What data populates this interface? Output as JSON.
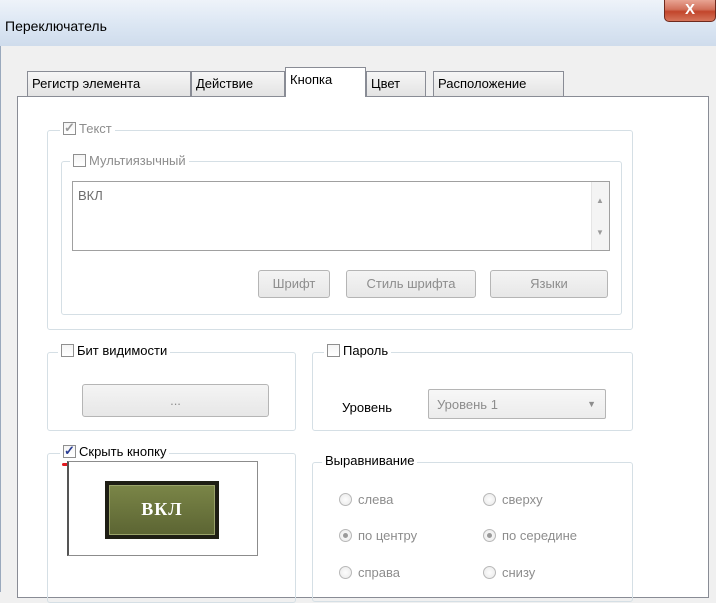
{
  "window": {
    "title": "Переключатель",
    "close_label": "X"
  },
  "tabs": [
    {
      "label": "Регистр элемента",
      "active": false
    },
    {
      "label": "Действие",
      "active": false
    },
    {
      "label": "Кнопка",
      "active": true
    },
    {
      "label": "Цвет",
      "active": false
    },
    {
      "label": "Расположение",
      "active": false
    }
  ],
  "text_group": {
    "legend": "Текст",
    "checked": true,
    "multilang": {
      "label": "Мультиязычный",
      "checked": false
    },
    "value": "ВКЛ",
    "buttons": {
      "font": "Шрифт",
      "font_style": "Стиль шрифта",
      "languages": "Языки"
    }
  },
  "visibility_bit": {
    "label": "Бит видимости",
    "checked": false,
    "button": "..."
  },
  "password": {
    "label": "Пароль",
    "checked": false,
    "level_label": "Уровень",
    "level_value": "Уровень 1"
  },
  "hide_button": {
    "label": "Скрыть кнопку",
    "checked": true,
    "preview_text": "ВКЛ"
  },
  "alignment": {
    "legend": "Выравнивание",
    "horizontal": [
      {
        "label": "слева",
        "selected": false
      },
      {
        "label": "по центру",
        "selected": true
      },
      {
        "label": "справа",
        "selected": false
      }
    ],
    "vertical": [
      {
        "label": "сверху",
        "selected": false
      },
      {
        "label": "по середине",
        "selected": true
      },
      {
        "label": "снизу",
        "selected": false
      }
    ]
  },
  "colors": {
    "highlight_underline": "#e0191f",
    "preview_face": "#6b7540",
    "close_button": "#c2452b"
  }
}
